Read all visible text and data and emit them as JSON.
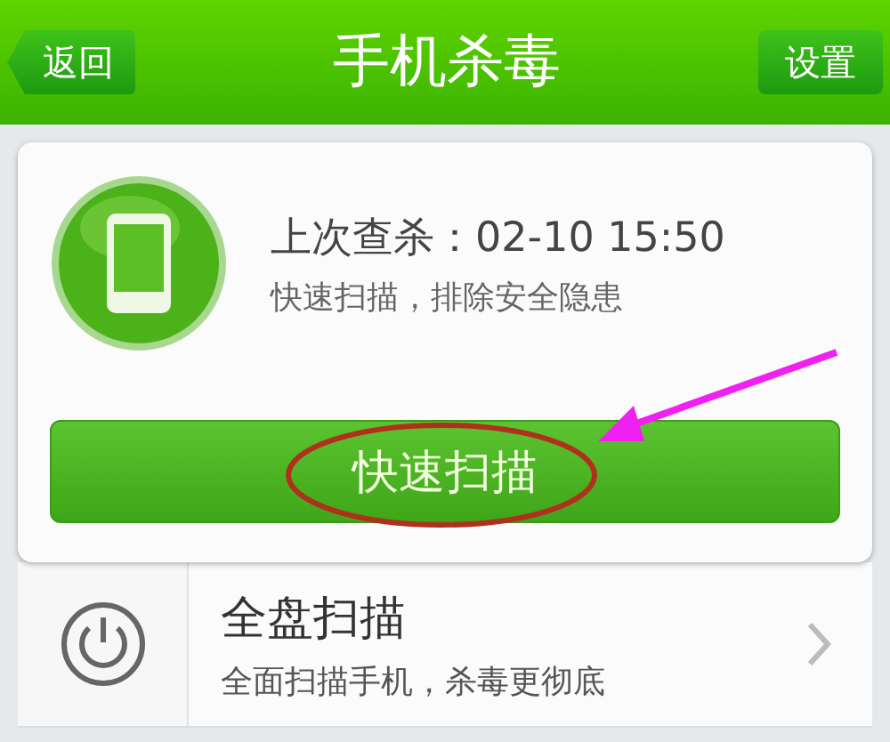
{
  "header": {
    "back": "返回",
    "title": "手机杀毒",
    "settings": "设置"
  },
  "status": {
    "label": "上次查杀：",
    "time": "02-10 15:50",
    "hint": "快速扫描，排除安全隐患"
  },
  "quick_scan": {
    "label": "快速扫描"
  },
  "options": [
    {
      "title": "全盘扫描",
      "subtitle": "全面扫描手机，杀毒更彻底"
    }
  ]
}
